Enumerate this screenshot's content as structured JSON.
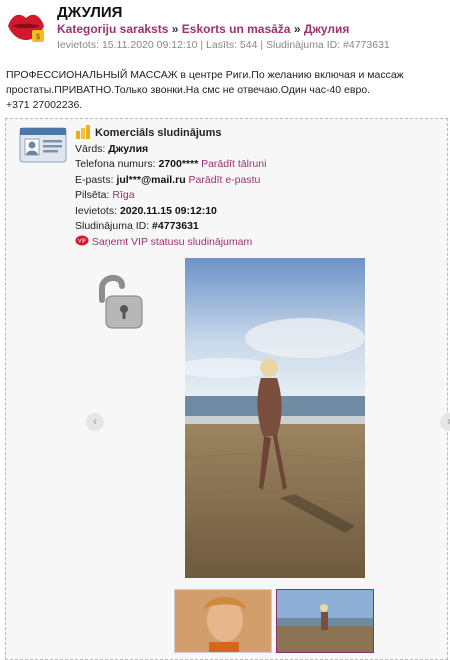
{
  "header": {
    "title": "ДЖУЛИЯ",
    "breadcrumb": {
      "item1": "Kategoriju saraksts",
      "sep1": "»",
      "item2": "Eskorts un masāža",
      "sep2": "»",
      "current": "Джулия"
    },
    "meta": "Ievietots: 15.11.2020 09:12:10 | Lasīts: 544 | Sludinājuma ID: #4773631"
  },
  "description": {
    "line1": "ПРОФЕССИОНАЛЬНЫЙ МАССАЖ в центре Риги.По желанию включая и массаж",
    "line2": "простаты.ПРИВАТНО.Только звонки.На смс не отвечаю.Один час-40 евро.",
    "line3": "+371 27002236."
  },
  "card": {
    "heading": "Komerciāls sludinājums",
    "name_label": "Vārds:",
    "name_value": "Джулия",
    "phone_label": "Telefona numurs:",
    "phone_value": "2700****",
    "phone_link": "Parādīt tālruni",
    "email_label": "E-pasts:",
    "email_value": "jul***@mail.ru",
    "email_link": "Parādīt e-pastu",
    "city_label": "Pilsēta:",
    "city_value": "Rīga",
    "posted_label": "Ievietots:",
    "posted_value": "2020.11.15 09:12:10",
    "id_label": "Sludinājuma ID:",
    "id_value": "#4773631",
    "vip_badge": "VIP",
    "vip_link": "Saņemt VIP statusu sludinājumam"
  },
  "gallery": {
    "prev": "‹",
    "next": "›"
  },
  "icons": [
    "lips-logo-icon",
    "coins-icon",
    "id-card-icon",
    "lock-icon",
    "vip-icon",
    "arrow-left-icon",
    "arrow-right-icon"
  ],
  "colors": {
    "accent": "#a0306e",
    "meta": "#888888",
    "panel": "#f7f7f7"
  }
}
